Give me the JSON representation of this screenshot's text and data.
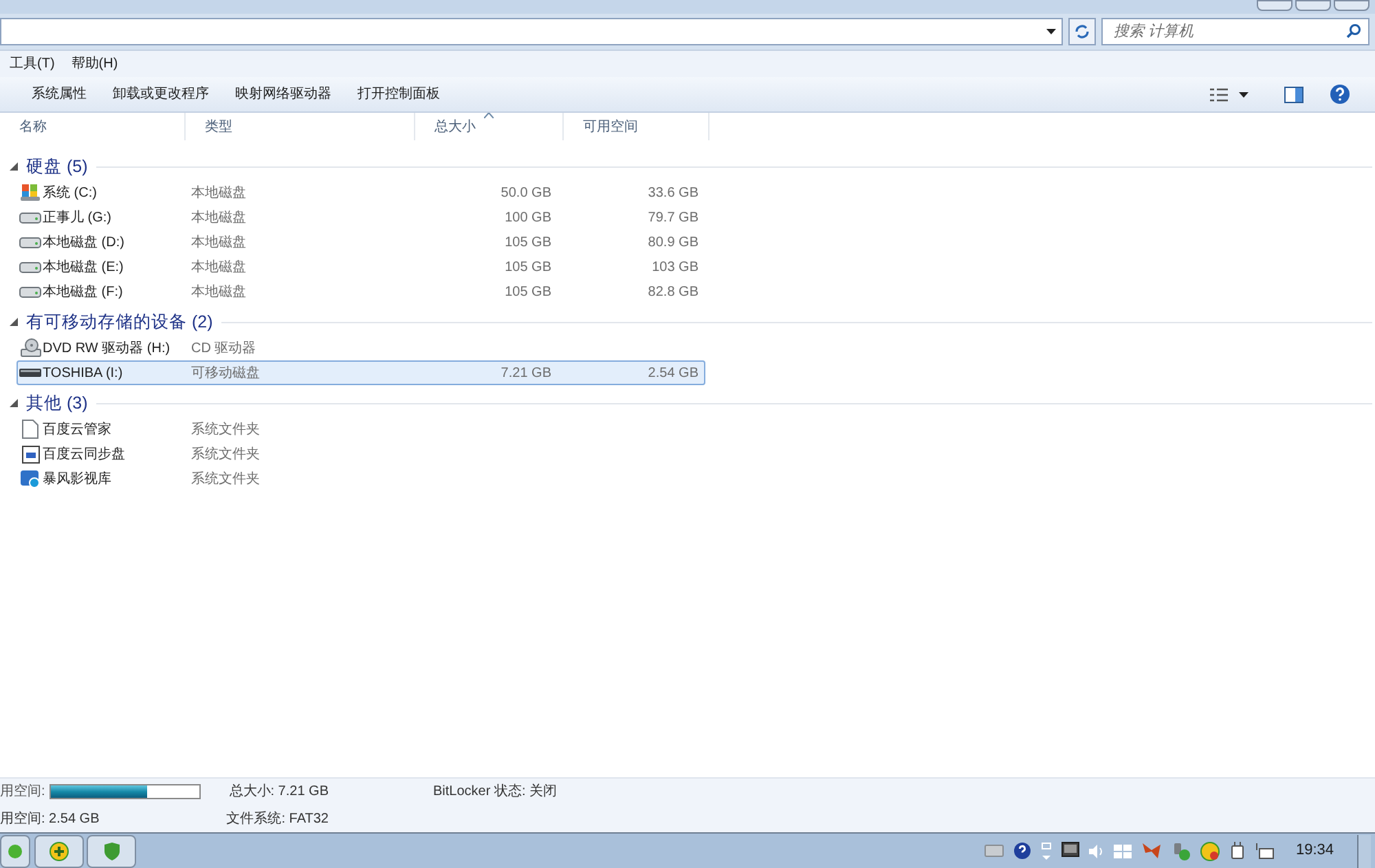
{
  "search": {
    "placeholder": "搜索 计算机"
  },
  "menu": [
    {
      "label": "工具(T)"
    },
    {
      "label": "帮助(H)"
    }
  ],
  "toolbar": [
    {
      "label": "系统属性"
    },
    {
      "label": "卸载或更改程序"
    },
    {
      "label": "映射网络驱动器"
    },
    {
      "label": "打开控制面板"
    }
  ],
  "columns": [
    {
      "label": "名称",
      "sorted": false
    },
    {
      "label": "类型",
      "sorted": false
    },
    {
      "label": "总大小",
      "sorted": true
    },
    {
      "label": "可用空间",
      "sorted": false
    }
  ],
  "groups": [
    {
      "title": "硬盘 (5)",
      "expanded": true,
      "items": [
        {
          "kind": "system",
          "name": "系统 (C:)",
          "type": "本地磁盘",
          "total": "50.0 GB",
          "free": "33.6 GB",
          "selected": false
        },
        {
          "kind": "disk",
          "name": "正事儿 (G:)",
          "type": "本地磁盘",
          "total": "100 GB",
          "free": "79.7 GB",
          "selected": false
        },
        {
          "kind": "disk",
          "name": "本地磁盘 (D:)",
          "type": "本地磁盘",
          "total": "105 GB",
          "free": "80.9 GB",
          "selected": false
        },
        {
          "kind": "disk",
          "name": "本地磁盘 (E:)",
          "type": "本地磁盘",
          "total": "105 GB",
          "free": "103 GB",
          "selected": false
        },
        {
          "kind": "disk",
          "name": "本地磁盘 (F:)",
          "type": "本地磁盘",
          "total": "105 GB",
          "free": "82.8 GB",
          "selected": false
        }
      ]
    },
    {
      "title": "有可移动存储的设备 (2)",
      "expanded": true,
      "items": [
        {
          "kind": "dvd",
          "name": "DVD RW 驱动器 (H:)",
          "type": "CD 驱动器",
          "selected": false
        },
        {
          "kind": "usb",
          "name": "TOSHIBA (I:)",
          "type": "可移动磁盘",
          "total": "7.21 GB",
          "free": "2.54 GB",
          "selected": true
        }
      ]
    },
    {
      "title": "其他 (3)",
      "expanded": true,
      "items": [
        {
          "kind": "file",
          "name": "百度云管家",
          "type": "系统文件夹",
          "selected": false
        },
        {
          "kind": "app",
          "name": "百度云同步盘",
          "type": "系统文件夹",
          "selected": false
        },
        {
          "kind": "media",
          "name": "暴风影视库",
          "type": "系统文件夹",
          "selected": false
        }
      ]
    }
  ],
  "details": {
    "used_label": "用空间:",
    "usage": {
      "level": 0.65
    },
    "free_label": "用空间: 2.54 GB",
    "total": "总大小: 7.21 GB",
    "fs": "文件系统: FAT32",
    "bitlocker": "BitLocker 状态: 关闭"
  },
  "clock": "19:34"
}
